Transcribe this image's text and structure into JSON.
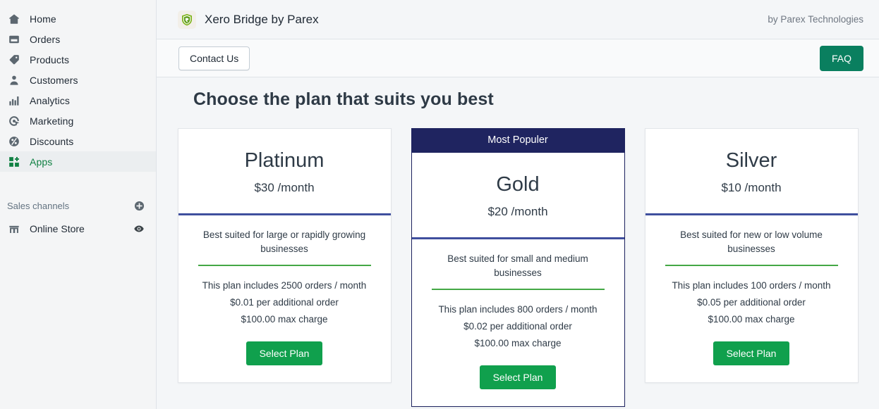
{
  "sidebar": {
    "items": [
      {
        "label": "Home",
        "icon": "home-icon",
        "active": false
      },
      {
        "label": "Orders",
        "icon": "orders-icon",
        "active": false
      },
      {
        "label": "Products",
        "icon": "products-icon",
        "active": false
      },
      {
        "label": "Customers",
        "icon": "customers-icon",
        "active": false
      },
      {
        "label": "Analytics",
        "icon": "analytics-icon",
        "active": false
      },
      {
        "label": "Marketing",
        "icon": "marketing-icon",
        "active": false
      },
      {
        "label": "Discounts",
        "icon": "discounts-icon",
        "active": false
      },
      {
        "label": "Apps",
        "icon": "apps-icon",
        "active": true
      }
    ],
    "sales_channels": {
      "title": "Sales channels",
      "add_icon": "plus-circle-icon",
      "channels": [
        {
          "label": "Online Store",
          "icon": "storefront-icon",
          "action_icon": "eye-icon"
        }
      ]
    }
  },
  "appbar": {
    "app_name": "Xero Bridge by Parex",
    "logo_icon": "parex-shield-logo-icon",
    "by_line": "by Parex Technologies"
  },
  "toolbar": {
    "contact_label": "Contact Us",
    "faq_label": "FAQ"
  },
  "main": {
    "page_title": "Choose the plan that suits you best",
    "plans": [
      {
        "name": "Platinum",
        "price": "$30 /month",
        "ribbon": null,
        "featured": false,
        "description": "Best suited for large or rapidly growing businesses",
        "features": [
          "This plan includes 2500 orders / month",
          "$0.01 per additional order",
          "$100.00 max charge"
        ],
        "cta_label": "Select Plan"
      },
      {
        "name": "Gold",
        "price": "$20 /month",
        "ribbon": "Most Populer",
        "featured": true,
        "description": "Best suited for small and medium businesses",
        "features": [
          "This plan includes 800 orders / month",
          "$0.02 per additional order",
          "$100.00 max charge"
        ],
        "cta_label": "Select Plan"
      },
      {
        "name": "Silver",
        "price": "$10 /month",
        "ribbon": null,
        "featured": false,
        "description": "Best suited for new or low volume businesses",
        "features": [
          "This plan includes 100 orders / month",
          "$0.05 per additional order",
          "$100.00 max charge"
        ],
        "cta_label": "Select Plan"
      }
    ]
  },
  "colors": {
    "navy": "#1f2460",
    "divider_blue": "#3f4f9e",
    "divider_green": "#44a845",
    "cta_green": "#10a04d",
    "faq_green": "#0a7f5f",
    "active_nav_green": "#108043"
  }
}
